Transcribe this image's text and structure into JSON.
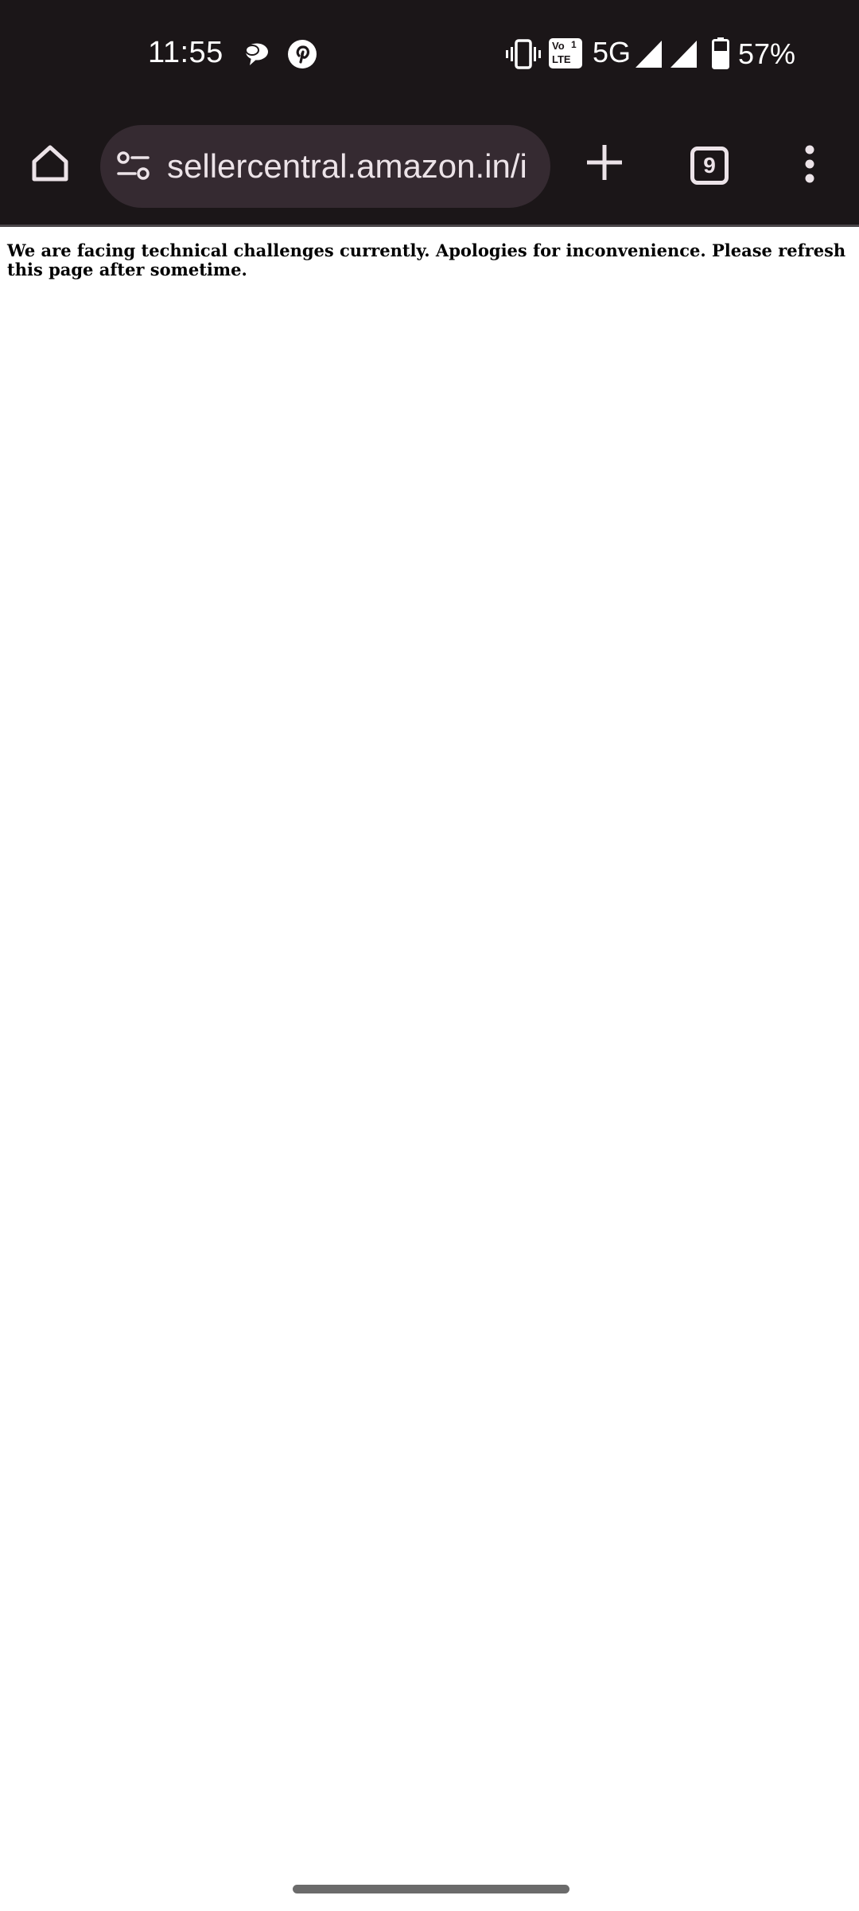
{
  "status_bar": {
    "time": "11:55",
    "network": "5G",
    "battery": "57%",
    "volte_top": "Vo",
    "volte_sim": "1",
    "volte_bottom": "LTE",
    "notification_icons": [
      "chat-bubble-icon",
      "pinterest-icon"
    ],
    "status_icons": [
      "vibrate-icon",
      "volte-icon",
      "signal-icon",
      "signal-icon",
      "battery-icon"
    ]
  },
  "browser": {
    "url": "sellercentral.amazon.in/i",
    "tab_count": "9",
    "icons": [
      "home-icon",
      "site-settings-icon",
      "new-tab-plus-icon",
      "tab-switcher-icon",
      "more-vert-icon"
    ]
  },
  "page": {
    "message": "We are facing technical challenges currently. Apologies for inconvenience. Please refresh this page after sometime."
  },
  "colors": {
    "chrome_bg": "#1b1618",
    "url_bar_bg": "#352a31",
    "page_bg": "#ffffff",
    "text": "#000000"
  }
}
